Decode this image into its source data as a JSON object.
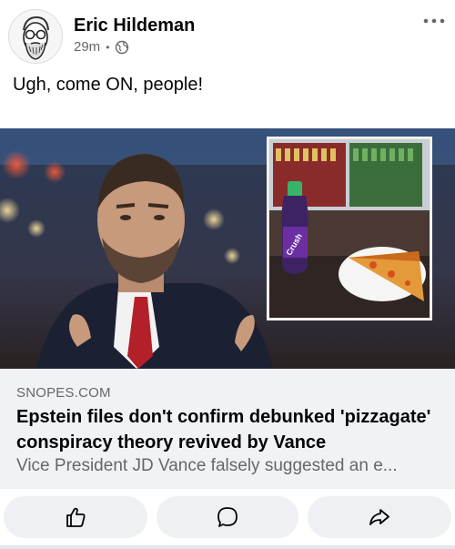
{
  "post": {
    "author": "Eric Hildeman",
    "time": "29m",
    "separator": "•",
    "privacy_icon": "globe-icon",
    "text": "Ugh, come ON, people!"
  },
  "link": {
    "domain": "SNOPES.COM",
    "headline": "Epstein files don't confirm debunked 'pizzagate' conspiracy theory revived by Vance",
    "description": "Vice President JD Vance falsely suggested an e..."
  },
  "image": {
    "soda_brand": "Crush"
  },
  "actions": {
    "like_icon": "thumbs-up-icon",
    "comment_icon": "comment-icon",
    "share_icon": "share-icon"
  },
  "colors": {
    "secondary_text": "#65676b",
    "link_bg": "#f0f2f5",
    "button_bg": "#eef0f3"
  }
}
